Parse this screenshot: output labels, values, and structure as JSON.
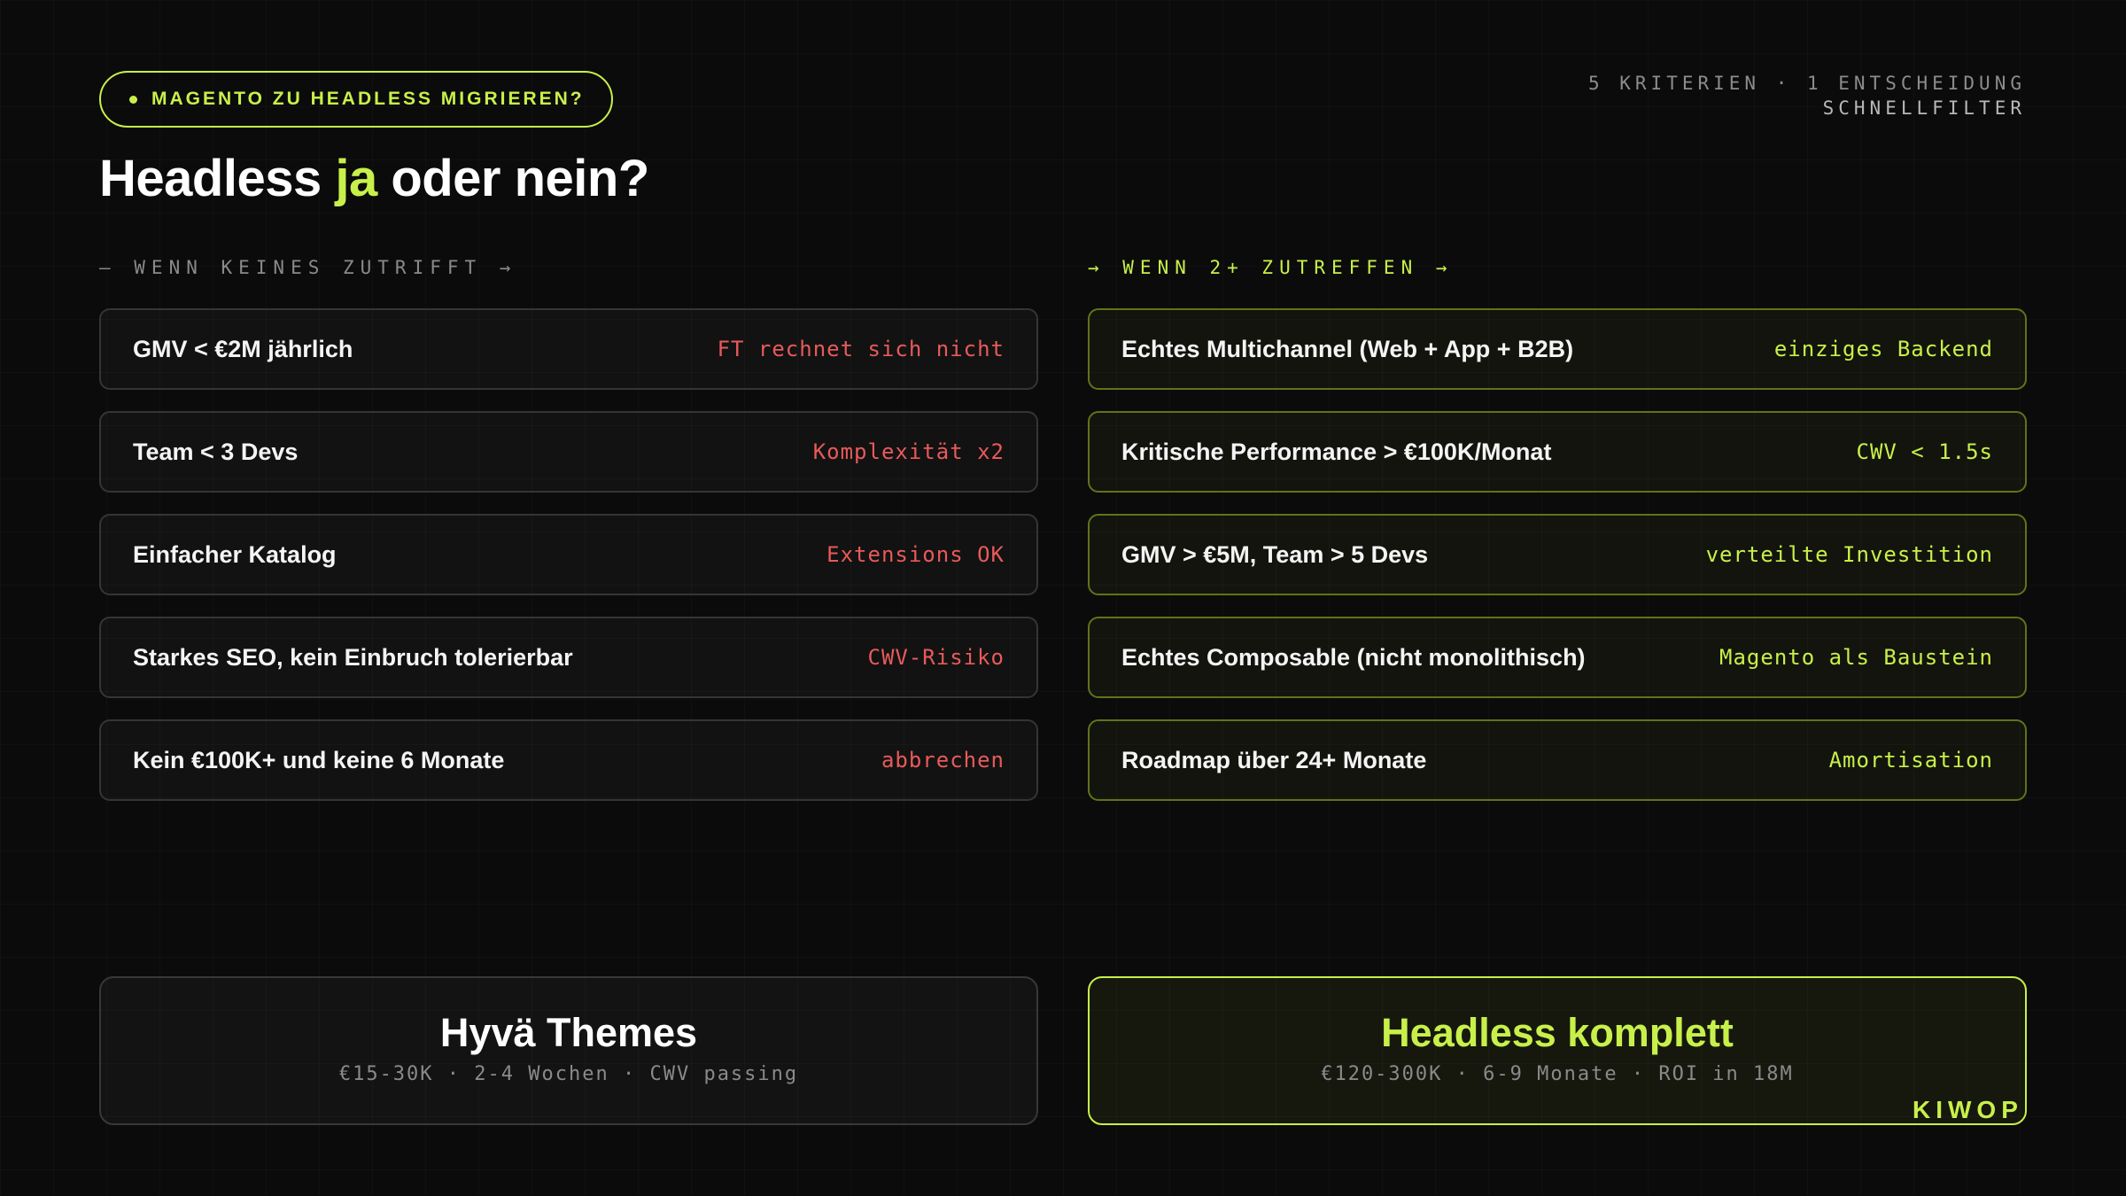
{
  "badge": {
    "label": "MAGENTO ZU HEADLESS MIGRIEREN?"
  },
  "meta": {
    "line1": "5 KRITERIEN · 1 ENTSCHEIDUNG",
    "line2": "SCHNELLFILTER"
  },
  "title": {
    "pre": "Headless ",
    "accent": "ja",
    "post": " oder nein?"
  },
  "left_column": {
    "label": "— WENN KEINES ZUTRIFFT →",
    "items": [
      {
        "label": "GMV < €2M jährlich",
        "tag": "FT rechnet sich nicht"
      },
      {
        "label": "Team < 3 Devs",
        "tag": "Komplexität x2"
      },
      {
        "label": "Einfacher Katalog",
        "tag": "Extensions OK"
      },
      {
        "label": "Starkes SEO, kein Einbruch tolerierbar",
        "tag": "CWV-Risiko"
      },
      {
        "label": "Kein €100K+ und keine 6 Monate",
        "tag": "abbrechen"
      }
    ],
    "result": {
      "title": "Hyvä Themes",
      "subtitle": "€15-30K · 2-4 Wochen · CWV passing"
    }
  },
  "right_column": {
    "label": "→ WENN 2+ ZUTREFFEN →",
    "items": [
      {
        "label": "Echtes Multichannel (Web + App + B2B)",
        "tag": "einziges Backend"
      },
      {
        "label": "Kritische Performance > €100K/Monat",
        "tag": "CWV < 1.5s"
      },
      {
        "label": "GMV > €5M, Team > 5 Devs",
        "tag": "verteilte Investition"
      },
      {
        "label": "Echtes Composable (nicht monolithisch)",
        "tag": "Magento als Baustein"
      },
      {
        "label": "Roadmap über 24+ Monate",
        "tag": "Amortisation"
      }
    ],
    "result": {
      "title": "Headless komplett",
      "subtitle": "€120-300K · 6-9 Monate · ROI in 18M"
    }
  },
  "brand": {
    "label": "KIWOP"
  },
  "colors": {
    "accent": "#c8f04a",
    "negative": "#e85a5a",
    "background": "#0b0b0b"
  }
}
